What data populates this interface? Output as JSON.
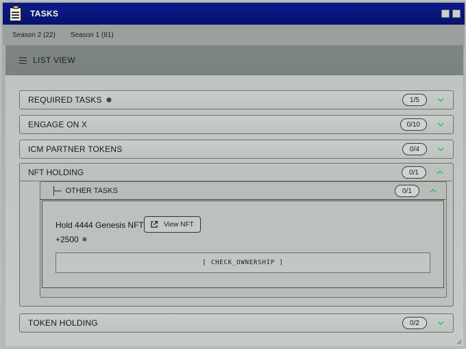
{
  "window": {
    "title": "TASKS"
  },
  "seasons": [
    {
      "label": "Season 2 (22)"
    },
    {
      "label": "Season 1 (81)"
    }
  ],
  "view": {
    "label": "LIST VIEW"
  },
  "colors": {
    "accent": "#2fbf5a",
    "titlebar": "#0b1a8a"
  },
  "tasks": {
    "required": {
      "label": "REQUIRED TASKS",
      "count": "1/5"
    },
    "engage": {
      "label": "ENGAGE ON X",
      "count": "0/10"
    },
    "icm": {
      "label": "ICM PARTNER TOKENS",
      "count": "0/4"
    },
    "nft": {
      "label": "NFT HOLDING",
      "count": "0/1",
      "sub": {
        "label": "OTHER TASKS",
        "count": "0/1",
        "item": {
          "title": "Hold 4444 Genesis NFT",
          "view_label": "View NFT",
          "reward": "+2500",
          "button": "[ CHECK_OWNERSHIP ]"
        }
      }
    },
    "token": {
      "label": "TOKEN HOLDING",
      "count": "0/2"
    }
  }
}
